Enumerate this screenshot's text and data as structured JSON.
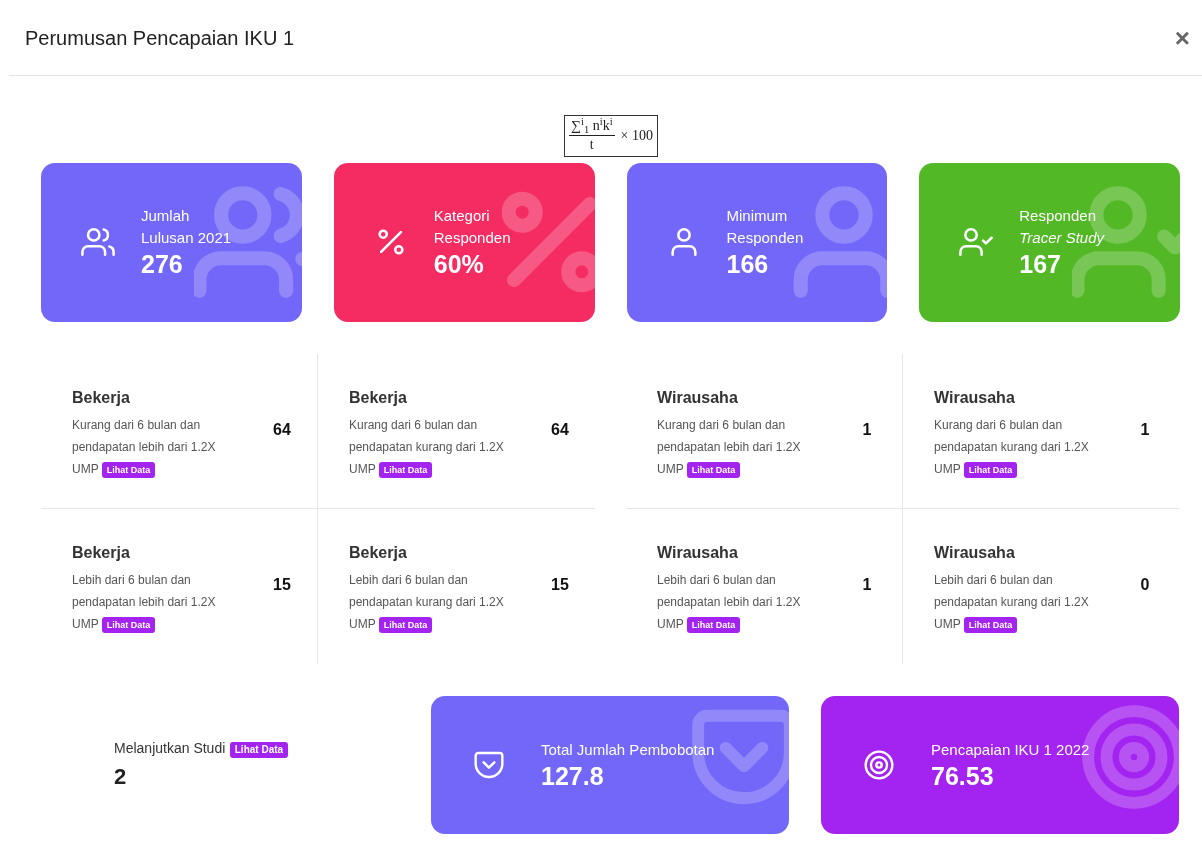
{
  "window": {
    "title": "Perumusan Pencapaian IKU 1",
    "close": "×"
  },
  "formula": {
    "numerator": "∑$^{i}$$_{1}$ n$^{i}$k$^{i}$",
    "denominator": "t",
    "suffix": "× 100"
  },
  "stat_cards": [
    {
      "kind": "users",
      "color": "#7367f9",
      "label_lines": [
        "Jumlah",
        "Lulusan 2021"
      ],
      "value": "276"
    },
    {
      "kind": "percent",
      "color": "#f42c62",
      "label_lines": [
        "Kategori",
        "Responden"
      ],
      "value": "60%"
    },
    {
      "kind": "user",
      "color": "#7367f9",
      "label_lines": [
        "Minimum",
        "Responden"
      ],
      "value": "166"
    },
    {
      "kind": "user-check",
      "color": "#52b826",
      "label_lines": [
        "Responden",
        "*Tracer Study*"
      ],
      "value": "167"
    }
  ],
  "groups": [
    {
      "cells": [
        {
          "title": "Bekerja",
          "description": "Kurang dari 6 bulan dan pendapatan lebih dari 1.2X UMP",
          "button": "Lihat Data",
          "count": "64"
        },
        {
          "title": "Bekerja",
          "description": "Kurang dari 6 bulan dan pendapatan kurang dari 1.2X UMP",
          "button": "Lihat Data",
          "count": "64"
        },
        {
          "title": "Bekerja",
          "description": "Lebih dari 6 bulan dan pendapatan lebih dari 1.2X UMP",
          "button": "Lihat Data",
          "count": "15"
        },
        {
          "title": "Bekerja",
          "description": "Lebih dari 6 bulan dan pendapatan kurang dari 1.2X UMP",
          "button": "Lihat Data",
          "count": "15"
        }
      ]
    },
    {
      "cells": [
        {
          "title": "Wirausaha",
          "description": "Kurang dari 6 bulan dan pendapatan lebih dari 1.2X UMP",
          "button": "Lihat Data",
          "count": "1"
        },
        {
          "title": "Wirausaha",
          "description": "Kurang dari 6 bulan dan pendapatan kurang dari 1.2X UMP",
          "button": "Lihat Data",
          "count": "1"
        },
        {
          "title": "Wirausaha",
          "description": "Lebih dari 6 bulan dan pendapatan lebih dari 1.2X UMP",
          "button": "Lihat Data",
          "count": "1"
        },
        {
          "title": "Wirausaha",
          "description": "Lebih dari 6 bulan dan pendapatan kurang dari 1.2X UMP",
          "button": "Lihat Data",
          "count": "0"
        }
      ]
    }
  ],
  "further_study": {
    "label": "Melanjutkan Studi",
    "button": "Lihat Data",
    "value": "2"
  },
  "summary_cards": [
    {
      "kind": "pocket",
      "color": "#7367f9",
      "label": "Total Jumlah Pembobotan",
      "value": "127.8"
    },
    {
      "kind": "target",
      "color": "#a323f0",
      "label": "Pencapaian IKU 1 2022",
      "value": "76.53"
    }
  ]
}
